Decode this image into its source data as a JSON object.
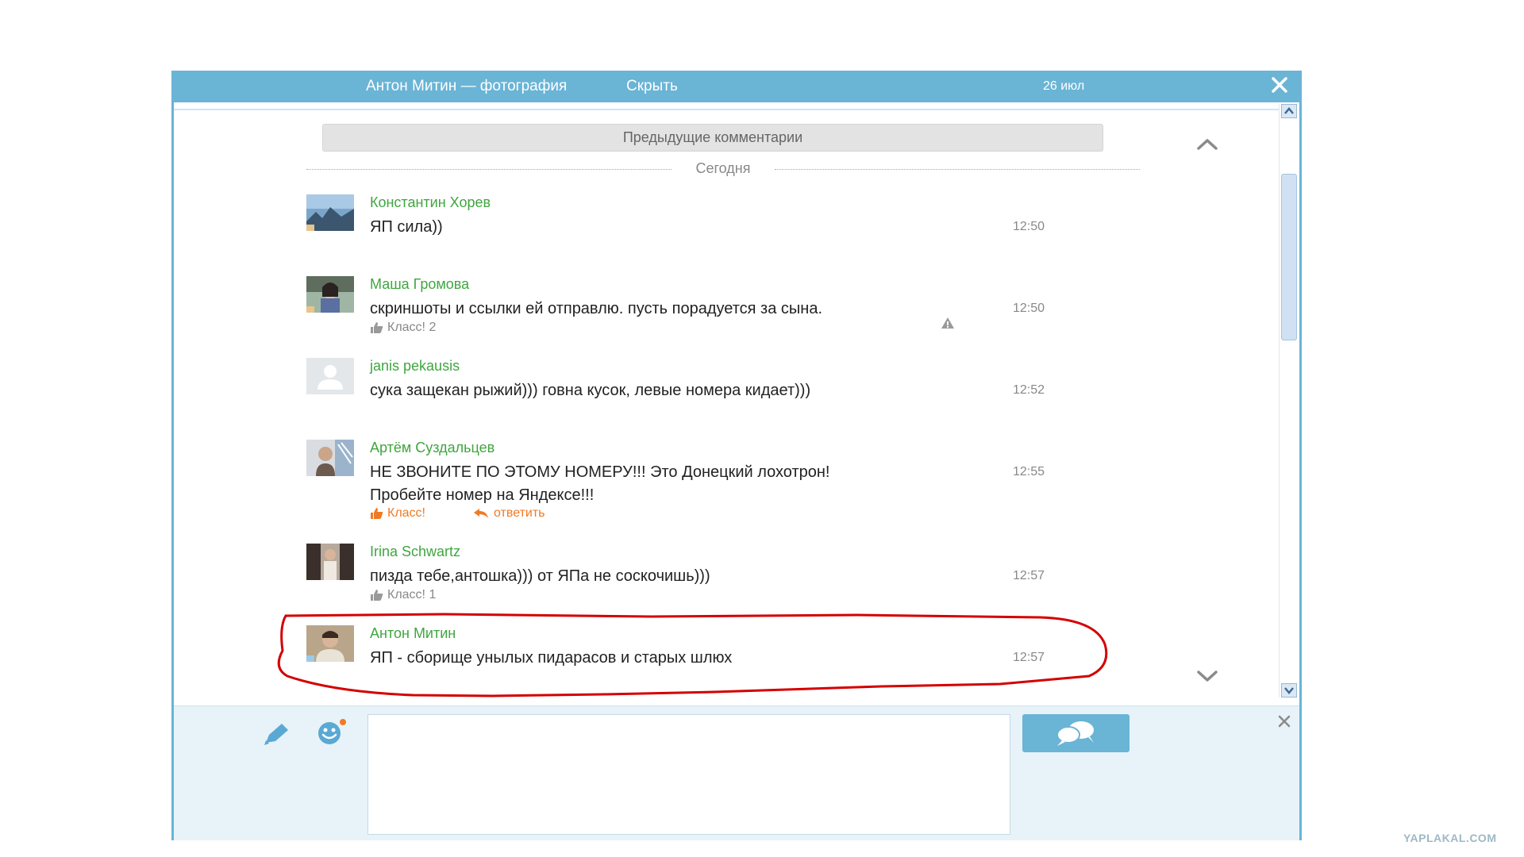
{
  "titlebar": {
    "title": "Антон Митин — фотография",
    "hide_label": "Скрыть",
    "date": "26 июл",
    "close_icon": "close-icon"
  },
  "prev_comments_label": "Предыдущие комментарии",
  "day_separator": "Сегодня",
  "comments": [
    {
      "author": "Константин Хорев",
      "text": "ЯП сила))",
      "time": "12:50"
    },
    {
      "author": "Маша Громова",
      "text": "скриншоты и ссылки ей отправлю. пусть порадуется за сына.",
      "time": "12:50",
      "likes": "Класс! 2"
    },
    {
      "author": "janis pekausis",
      "text": "сука защекан рыжий))) говна кусок, левые номера кидает)))",
      "time": "12:52"
    },
    {
      "author": "Артём Суздальцев",
      "text_lines": [
        "НЕ ЗВОНИТЕ ПО ЭТОМУ НОМЕРУ!!! Это Донецкий лохотрон!",
        "Пробейте номер на Яндексе!!!"
      ],
      "time": "12:55",
      "likes": "Класс!",
      "reply": "ответить"
    },
    {
      "author": "Irina Schwartz",
      "text": "пизда тебе,антошка))) от ЯПа не соскочишь)))",
      "time": "12:57",
      "likes": "Класс! 1"
    },
    {
      "author": "Антон Митин",
      "text": "ЯП - сборище унылых пидарасов и старых шлюх",
      "time": "12:57"
    }
  ],
  "colors": {
    "header": "#6ab4d6",
    "author": "#3fa63f",
    "accent_orange": "#f07a24",
    "highlight_red": "#d40000",
    "composer_bg": "#e7f3f9"
  },
  "icons": [
    "close-icon",
    "chevron-up-icon",
    "chevron-down-icon",
    "thumbs-up-icon",
    "reply-arrow-icon",
    "warning-icon",
    "pencil-icon",
    "smile-icon",
    "send-chat-icon"
  ],
  "watermark": "YAPLAKAL.COM"
}
